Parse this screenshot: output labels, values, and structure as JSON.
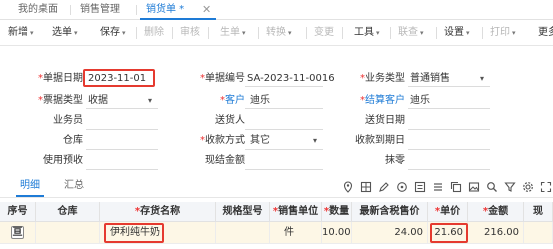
{
  "tabs": [
    {
      "label": "我的桌面"
    },
    {
      "label": "销售管理"
    },
    {
      "label": "销货单 *"
    }
  ],
  "tab_close": "✕",
  "toolbar": {
    "items": [
      {
        "label": "新增",
        "caret": "▾",
        "disabled": false
      },
      {
        "label": "选单",
        "caret": "▾",
        "disabled": false
      },
      {
        "label": "保存",
        "caret": "▾",
        "disabled": false
      },
      {
        "label": "删除",
        "caret": "",
        "disabled": true
      },
      {
        "label": "审核",
        "caret": "",
        "disabled": true
      },
      {
        "label": "生单",
        "caret": "▾",
        "disabled": true
      },
      {
        "label": "转换",
        "caret": "▾",
        "disabled": true
      },
      {
        "label": "变更",
        "caret": "",
        "disabled": true
      },
      {
        "label": "工具",
        "caret": "▾",
        "disabled": false
      },
      {
        "label": "联查",
        "caret": "▾",
        "disabled": true
      },
      {
        "label": "设置",
        "caret": "▾",
        "disabled": false
      },
      {
        "label": "打印",
        "caret": "▾",
        "disabled": true
      },
      {
        "label": "更多",
        "caret": "",
        "disabled": false
      }
    ]
  },
  "form": {
    "doc_date": {
      "label": "单据日期",
      "required": "*",
      "value": "2023-11-01"
    },
    "doc_no": {
      "label": "单据编号",
      "required": "*",
      "value": "SA-2023-11-0016"
    },
    "biz_type": {
      "label": "业务类型",
      "required": "*",
      "value": "普通销售"
    },
    "invoice_type": {
      "label": "票据类型",
      "required": "*",
      "value": "收据"
    },
    "customer": {
      "label": "客户",
      "required": "*",
      "value": "迪乐"
    },
    "settle_customer": {
      "label": "结算客户",
      "required": "*",
      "value": "迪乐"
    },
    "salesman": {
      "label": "业务员",
      "value": ""
    },
    "deliverer": {
      "label": "送货人",
      "value": ""
    },
    "delivery_date": {
      "label": "送货日期",
      "value": ""
    },
    "warehouse": {
      "label": "仓库",
      "value": ""
    },
    "payment_method": {
      "label": "收款方式",
      "required": "*",
      "value": "其它"
    },
    "due_date": {
      "label": "收款到期日",
      "value": ""
    },
    "prepaid": {
      "label": "使用预收",
      "value": ""
    },
    "cash_amount": {
      "label": "现结金额",
      "value": ""
    },
    "discount": {
      "label": "抹零",
      "value": ""
    }
  },
  "subtabs": [
    {
      "label": "明细"
    },
    {
      "label": "汇总"
    }
  ],
  "subtab_icons": [
    "location-icon",
    "grid-icon",
    "edit-icon",
    "circle-icon",
    "list-icon",
    "lines-icon",
    "copy-icon",
    "image-icon",
    "search-icon",
    "filter-icon",
    "settings-icon",
    "expand-icon"
  ],
  "grid": {
    "headers": [
      {
        "label": "序号",
        "required": ""
      },
      {
        "label": "仓库",
        "required": ""
      },
      {
        "label": "存货名称",
        "required": "*"
      },
      {
        "label": "规格型号",
        "required": ""
      },
      {
        "label": "销售单位",
        "required": "*"
      },
      {
        "label": "数量",
        "required": "*"
      },
      {
        "label": "最新含税售价",
        "required": ""
      },
      {
        "label": "单价",
        "required": "*"
      },
      {
        "label": "金额",
        "required": "*"
      },
      {
        "label": "现",
        "required": ""
      }
    ],
    "row": {
      "index_icon": "亘",
      "warehouse": "",
      "item_name": "伊利纯牛奶",
      "spec": "",
      "unit": "件",
      "qty": "10.00",
      "latest_price": "24.00",
      "unit_price": "21.60",
      "amount": "216.00",
      "extra": ""
    }
  },
  "colors": {
    "accent": "#1e7bd6",
    "highlight_box": "#e53a2f",
    "required": "#e33",
    "row_bg": "#fdf7e6"
  }
}
